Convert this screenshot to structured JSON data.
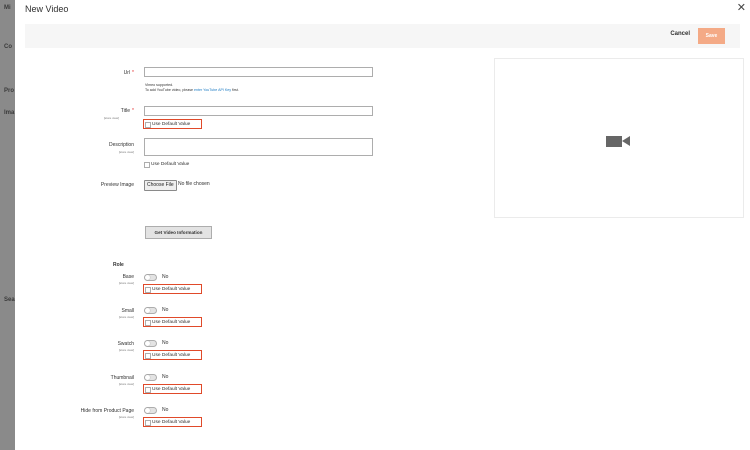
{
  "background": {
    "fragments": [
      "Mi",
      "Co",
      "Pro",
      "Ima",
      "Sea"
    ]
  },
  "modal": {
    "title": "New Video",
    "close_icon": "close-icon"
  },
  "actions": {
    "cancel_label": "Cancel",
    "save_label": "Save"
  },
  "form": {
    "url": {
      "label": "Url",
      "value": "",
      "note_line1": "Vimeo supported.",
      "note_line2_prefix": "To add YouTube video, please ",
      "note_link": "enter YouTube API Key",
      "note_line2_suffix": " first."
    },
    "title": {
      "label": "Title",
      "scope": "[store view]",
      "value": "",
      "use_default_label": "Use Default Value"
    },
    "description": {
      "label": "Description",
      "scope": "[store view]",
      "value": "",
      "use_default_label": "Use Default Value"
    },
    "preview_image": {
      "label": "Preview Image",
      "button_label": "Choose File",
      "status": "No file chosen"
    },
    "get_info_label": "Get Video Information",
    "role_heading": "Role",
    "roles": [
      {
        "label": "Base",
        "scope": "[store view]",
        "toggle_state": "No",
        "use_default_label": "Use Default Value"
      },
      {
        "label": "Small",
        "scope": "[store view]",
        "toggle_state": "No",
        "use_default_label": "Use Default Value"
      },
      {
        "label": "Swatch",
        "scope": "[store view]",
        "toggle_state": "No",
        "use_default_label": "Use Default Value"
      },
      {
        "label": "Thumbnail",
        "scope": "[store view]",
        "toggle_state": "No",
        "use_default_label": "Use Default Value"
      },
      {
        "label": "Hide from Product Page",
        "scope": "[store view]",
        "toggle_state": "No",
        "use_default_label": "Use Default Value"
      }
    ]
  },
  "preview": {
    "icon": "video-camera-icon"
  },
  "colors": {
    "save_button": "#f4aa86",
    "highlight_border": "#e04a2a",
    "link": "#1979c3"
  }
}
